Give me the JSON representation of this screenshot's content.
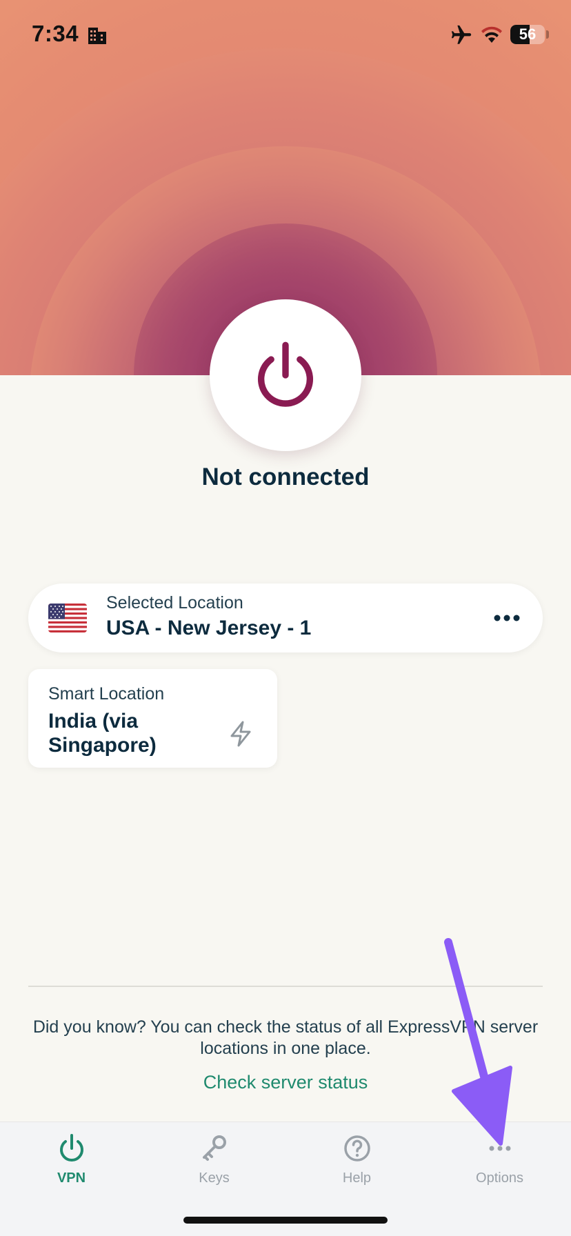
{
  "status_bar": {
    "time": "7:34",
    "battery": "56",
    "battery_level": 0.56,
    "icons": [
      "building-icon",
      "airplane-icon",
      "wifi-icon",
      "battery-icon"
    ]
  },
  "connection": {
    "status": "Not connected",
    "power_icon": "power-icon"
  },
  "selected_location": {
    "label": "Selected Location",
    "value": "USA - New Jersey - 1",
    "flag": "us-flag-icon",
    "more_icon": "more-horizontal-icon"
  },
  "smart_location": {
    "label": "Smart Location",
    "value": "India (via Singapore)",
    "icon": "lightning-icon"
  },
  "tip": {
    "text": "Did you know? You can check the status of all ExpressVPN server locations in one place.",
    "link": "Check server status"
  },
  "tabs": [
    {
      "label": "VPN",
      "icon": "power-icon",
      "active": true
    },
    {
      "label": "Keys",
      "icon": "key-icon",
      "active": false
    },
    {
      "label": "Help",
      "icon": "help-circle-icon",
      "active": false
    },
    {
      "label": "Options",
      "icon": "more-horizontal-icon",
      "active": false
    }
  ],
  "colors": {
    "accent_green": "#1f8a6e",
    "power_magenta": "#8a1b52",
    "text_dark": "#0d2b3e",
    "annotation_purple": "#8b5cf6"
  }
}
